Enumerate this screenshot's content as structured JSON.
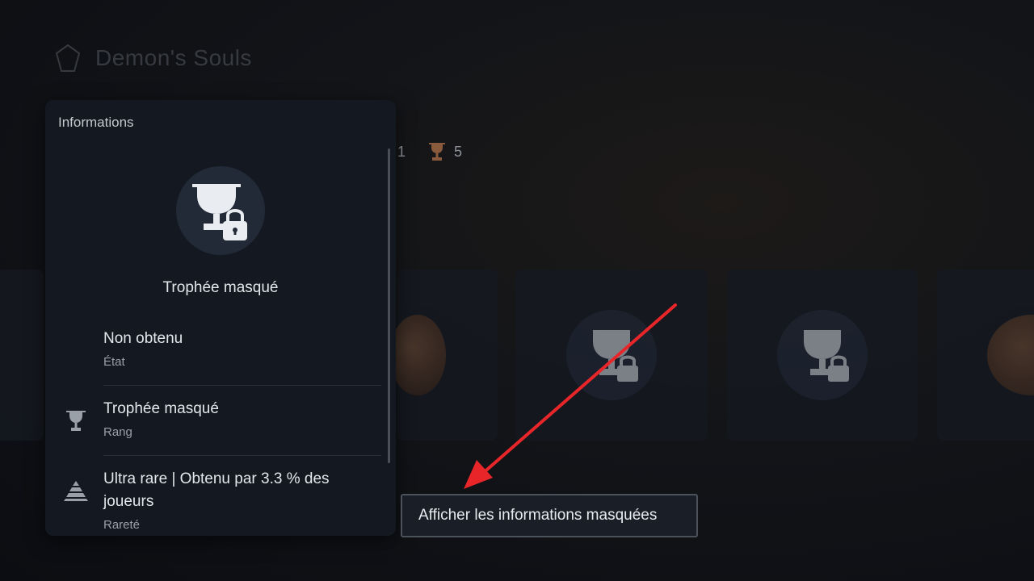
{
  "background": {
    "game_title": "Demon's Souls",
    "trophy_counts": [
      {
        "type": "silver",
        "count": "1"
      },
      {
        "type": "bronze",
        "count": "5"
      }
    ]
  },
  "panel": {
    "title": "Informations",
    "trophy_name": "Trophée masqué",
    "details": [
      {
        "value": "Non obtenu",
        "label": "État",
        "icon": "none"
      },
      {
        "value": "Trophée masqué",
        "label": "Rang",
        "icon": "trophy-icon"
      },
      {
        "value": "Ultra rare | Obtenu par 3.3 % des joueurs",
        "label": "Rareté",
        "icon": "rarity-pyramid-icon"
      }
    ]
  },
  "action": {
    "reveal_label": "Afficher les informations masquées"
  },
  "colors": {
    "annotation_arrow": "#e8262a",
    "panel_bg": "#141921",
    "bronze": "#8a5a3c"
  }
}
